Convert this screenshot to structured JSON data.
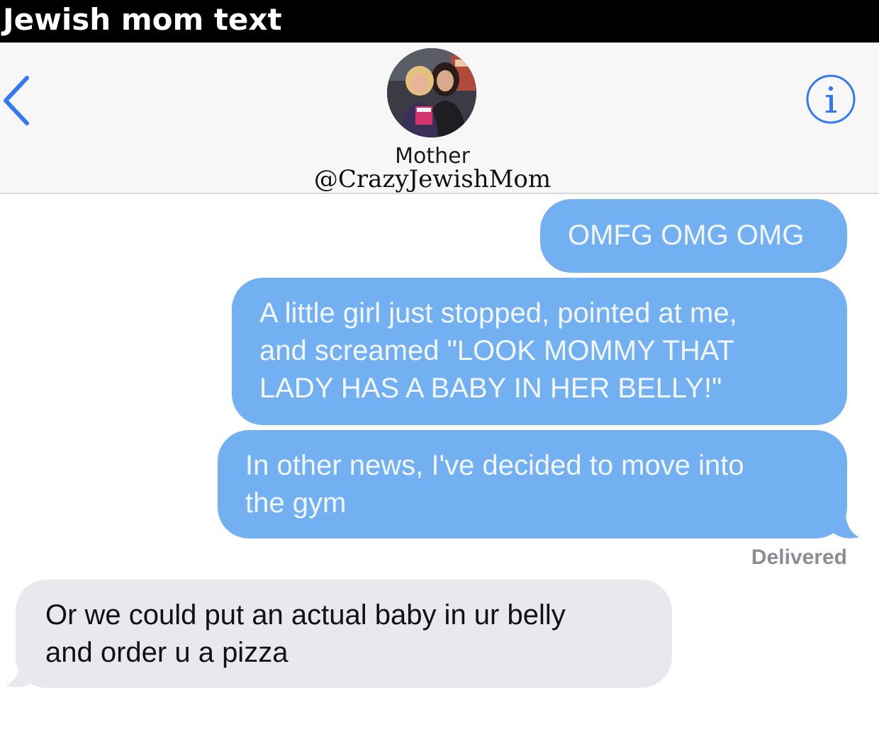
{
  "caption": "Jewish mom text",
  "header": {
    "contact_name": "Mother",
    "contact_handle": "@CrazyJewishMom",
    "back_icon": "chevron-left-icon",
    "info_icon": "info-icon",
    "accent_color": "#3478f6"
  },
  "messages": [
    {
      "direction": "sent",
      "lines": [
        "OMFG OMG OMG"
      ]
    },
    {
      "direction": "sent",
      "lines": [
        "A little girl just stopped, pointed at me,",
        "and screamed \"LOOK MOMMY THAT",
        "LADY HAS A BABY IN HER BELLY!\""
      ]
    },
    {
      "direction": "sent",
      "lines": [
        "In other news, I've decided to move into",
        "the gym"
      ]
    },
    {
      "direction": "received",
      "lines": [
        "Or we could put an actual baby in ur belly",
        "and order u a pizza"
      ]
    }
  ],
  "delivery_status": "Delivered",
  "colors": {
    "sent_bubble": "#72b0f2",
    "received_bubble": "#e8e8ee",
    "header_background": "#f7f7f8"
  }
}
